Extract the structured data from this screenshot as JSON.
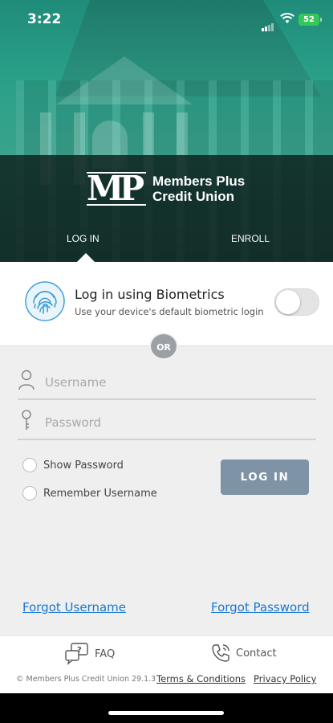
{
  "status_bar": {
    "time": "3:22",
    "battery": "52"
  },
  "brand": {
    "logo_mark": "MP",
    "line1": "Members Plus",
    "line2": "Credit Union"
  },
  "tabs": [
    {
      "label": "LOG IN",
      "active": true
    },
    {
      "label": "ENROLL",
      "active": false
    }
  ],
  "biometrics": {
    "icon": "fingerprint-icon",
    "title": "Log in using Biometrics",
    "subtitle": "Use your device's default biometric login",
    "enabled": false
  },
  "divider": {
    "label": "OR"
  },
  "form": {
    "username": {
      "placeholder": "Username",
      "value": "",
      "icon": "user-icon"
    },
    "password": {
      "placeholder": "Password",
      "value": "",
      "icon": "key-icon"
    },
    "show_password": {
      "label": "Show Password",
      "checked": false
    },
    "remember_username": {
      "label": "Remember Username",
      "checked": false
    },
    "login_button": "LOG IN"
  },
  "links": {
    "forgot_username": "Forgot Username",
    "forgot_password": "Forgot Password"
  },
  "footer": {
    "faq": {
      "label": "FAQ",
      "icon": "faq-chat-icon"
    },
    "contact": {
      "label": "Contact",
      "icon": "phone-icon"
    },
    "copyright": "© Members Plus Credit Union 29.1.3",
    "terms": "Terms & Conditions",
    "privacy": "Privacy Policy"
  },
  "colors": {
    "accent_teal": "#2aa089",
    "button": "#7e93a6",
    "link": "#1a76d2",
    "battery": "#34c759"
  }
}
